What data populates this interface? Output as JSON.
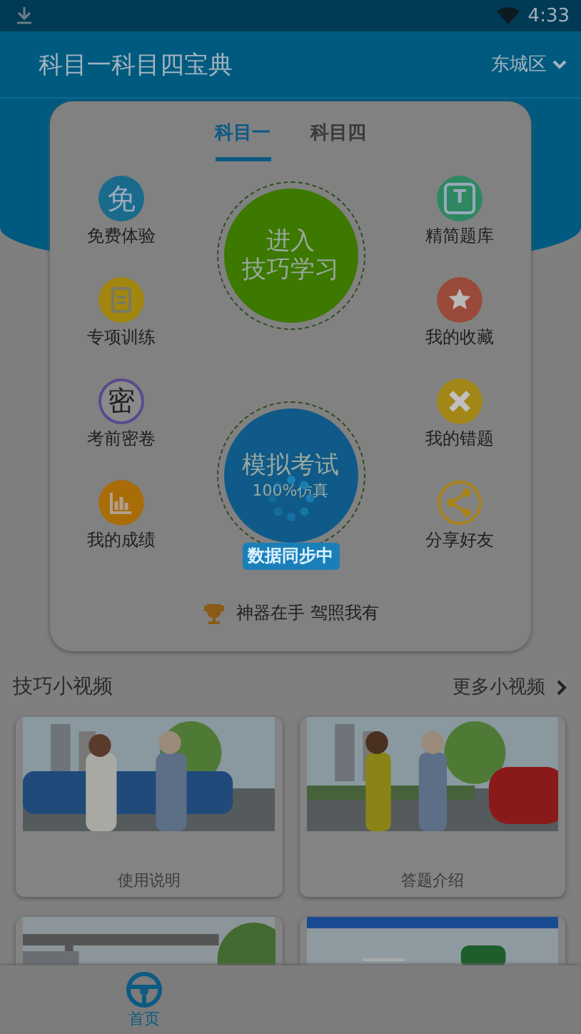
{
  "status_bar": {
    "time": "4:33"
  },
  "header": {
    "title": "科目一科目四宝典",
    "city": "东城区"
  },
  "tabs": [
    {
      "label": "科目一",
      "selected": true
    },
    {
      "label": "科目四",
      "selected": false
    }
  ],
  "left_features": [
    {
      "label": "免费体验",
      "kind": "glyph",
      "glyph": "免",
      "color": "#1a6a8c"
    },
    {
      "label": "专项训练",
      "kind": "clipboard",
      "color": "#a38610"
    },
    {
      "label": "考前密卷",
      "kind": "ring",
      "glyph": "密",
      "color": "#5b4a8e"
    },
    {
      "label": "我的成绩",
      "kind": "chart",
      "color": "#a86d08"
    }
  ],
  "right_features": [
    {
      "label": "精简题库",
      "kind": "tile",
      "glyph": "T",
      "color": "#2e8760"
    },
    {
      "label": "我的收藏",
      "kind": "star",
      "color": "#9a4a3a"
    },
    {
      "label": "我的错题",
      "kind": "cross",
      "color": "#a38618"
    },
    {
      "label": "分享好友",
      "kind": "share",
      "color": "#a8821a"
    }
  ],
  "circles": [
    {
      "line1": "进入",
      "line2": "技巧学习",
      "color": "#3d7800"
    },
    {
      "line1": "模拟考试",
      "line2": "100%仿真",
      "color": "#0f5a88"
    }
  ],
  "loading": {
    "text": "数据同步中"
  },
  "slogan": "神器在手  驾照我有",
  "videos": {
    "title": "技巧小视频",
    "more": "更多小视频",
    "cards": [
      {
        "label": "使用说明",
        "kind": "picture"
      },
      {
        "label": "答题介绍",
        "kind": "picture"
      },
      {
        "kind": "picture"
      },
      {
        "kind": "picture"
      }
    ]
  },
  "bottom_nav": [
    {
      "label": "首页",
      "selected": true
    }
  ]
}
